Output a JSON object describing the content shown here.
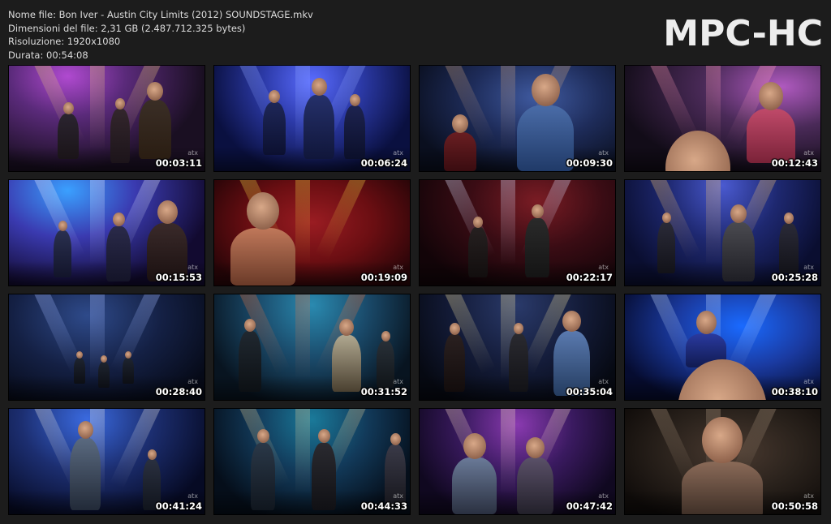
{
  "header": {
    "file_name": "Nome file: Bon Iver - Austin City Limits (2012) SOUNDSTAGE.mkv",
    "file_size": "Dimensioni del file: 2,31 GB (2.487.712.325 bytes)",
    "resolution": "Risoluzione: 1920x1080",
    "duration": "Durata: 00:54:08"
  },
  "logo": "MPC-HC",
  "thumbnails": [
    {
      "time": "00:03:11",
      "palette": "purple-stage"
    },
    {
      "time": "00:06:24",
      "palette": "blue-stage"
    },
    {
      "time": "00:09:30",
      "palette": "blue-closeup"
    },
    {
      "time": "00:12:43",
      "palette": "keyboard-pink"
    },
    {
      "time": "00:15:53",
      "palette": "horns-blue-purple"
    },
    {
      "time": "00:19:09",
      "palette": "red-closeup"
    },
    {
      "time": "00:22:17",
      "palette": "red-stage"
    },
    {
      "time": "00:25:28",
      "palette": "skyline-blue"
    },
    {
      "time": "00:28:40",
      "palette": "wide-dark-blue"
    },
    {
      "time": "00:31:52",
      "palette": "teal-stage"
    },
    {
      "time": "00:35:04",
      "palette": "skyline-keys"
    },
    {
      "time": "00:38:10",
      "palette": "drums-blue"
    },
    {
      "time": "00:41:24",
      "palette": "guitar-blue"
    },
    {
      "time": "00:44:33",
      "palette": "guitars-teal"
    },
    {
      "time": "00:47:42",
      "palette": "purple-guitar"
    },
    {
      "time": "00:50:58",
      "palette": "sepia-portrait"
    }
  ],
  "watermark": "atx",
  "colors": {
    "background": "#1c1c1c",
    "text": "#dcdcdc",
    "logo": "#ededed"
  }
}
